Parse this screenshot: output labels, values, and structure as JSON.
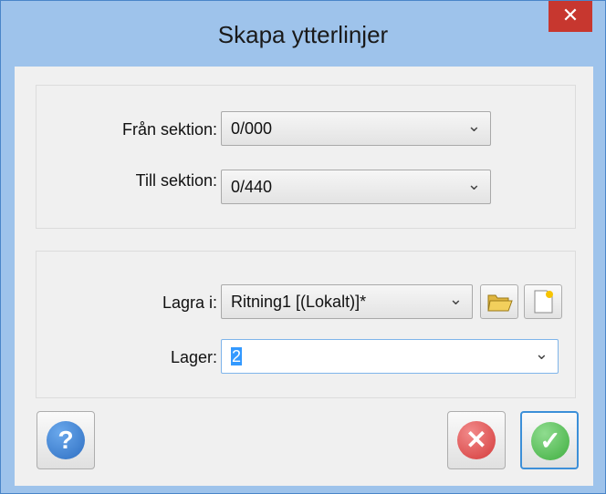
{
  "window": {
    "title": "Skapa ytterlinjer",
    "close_glyph": "✕"
  },
  "section": {
    "from_label": "Från sektion:",
    "from_value": "0/000",
    "to_label": "Till sektion:",
    "to_value": "0/440"
  },
  "storage": {
    "save_in_label": "Lagra i:",
    "save_in_value": "Ritning1 [(Lokalt)]*",
    "layer_label": "Lager:",
    "layer_value": "2"
  },
  "icons": {
    "help": "question-circle-icon",
    "cancel": "red-x-circle-icon",
    "ok": "green-check-circle-icon",
    "open_folder": "open-folder-icon",
    "new_document": "new-document-icon"
  },
  "colors": {
    "title_bg": "#9ec3eb",
    "close_bg": "#c7372f",
    "help": "#2e6fc2",
    "cancel": "#d43a3a",
    "ok": "#3fae3f"
  }
}
